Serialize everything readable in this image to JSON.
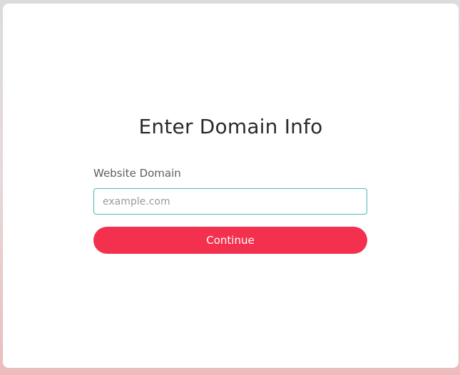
{
  "form": {
    "title": "Enter Domain Info",
    "domain_label": "Website Domain",
    "domain_value": "",
    "domain_placeholder": "example.com",
    "continue_label": "Continue"
  },
  "colors": {
    "accent": "#f3314f",
    "input_border": "#4db8b6"
  }
}
